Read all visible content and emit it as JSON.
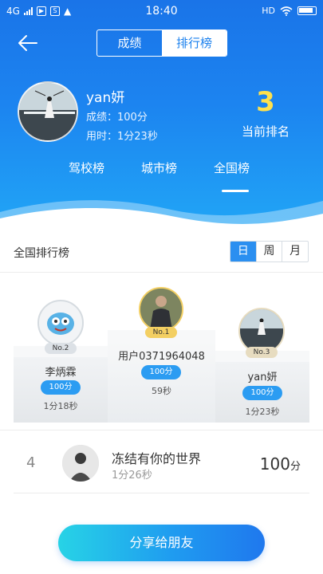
{
  "status_bar": {
    "network": "4G",
    "time": "18:40",
    "hd_label": "HD",
    "icons": [
      "signal-icon",
      "play-icon",
      "s-icon",
      "warning-icon",
      "wifi-icon",
      "battery-icon"
    ]
  },
  "header": {
    "segments": [
      {
        "label": "成绩",
        "active": false
      },
      {
        "label": "排行榜",
        "active": true
      }
    ],
    "user": {
      "name": "yan妍",
      "score_label": "成绩：100分",
      "time_label": "用时：1分23秒"
    },
    "rank": {
      "value": "3",
      "label": "当前排名"
    },
    "scope_tabs": [
      {
        "label": "驾校榜",
        "active": false
      },
      {
        "label": "城市榜",
        "active": false
      },
      {
        "label": "全国榜",
        "active": true
      }
    ]
  },
  "leaderboard": {
    "title": "全国排行榜",
    "periods": [
      {
        "label": "日",
        "active": true
      },
      {
        "label": "周",
        "active": false
      },
      {
        "label": "月",
        "active": false
      }
    ]
  },
  "podium": {
    "first": {
      "medal": "No.1",
      "name": "用户0371964048",
      "score": "100分",
      "time": "59秒"
    },
    "second": {
      "medal": "No.2",
      "name": "李炳霖",
      "score": "100分",
      "time": "1分18秒"
    },
    "third": {
      "medal": "No.3",
      "name": "yan妍",
      "score": "100分",
      "time": "1分23秒"
    }
  },
  "list": [
    {
      "rank": "4",
      "name": "冻结有你的世界",
      "time": "1分26秒",
      "score": "100",
      "unit": "分"
    }
  ],
  "share_button": "分享给朋友",
  "colors": {
    "header_blue": "#1c84f0",
    "accent_blue": "#2b8ff0",
    "rank_yellow": "#ffe14d",
    "gold_medal": "#f3cf62"
  }
}
